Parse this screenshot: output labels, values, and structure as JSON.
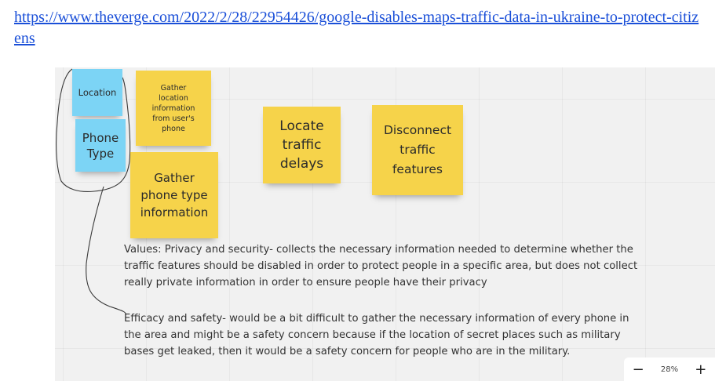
{
  "link": {
    "text": "https://www.theverge.com/2022/2/28/22954426/google-disables-maps-traffic-data-in-ukraine-to-protect-citizens"
  },
  "stickies": {
    "location": "Location",
    "phone_type": "Phone\nType",
    "gather_location": "Gather\nlocation\ninformation\nfrom user's\nphone",
    "gather_phone_type": "Gather\nphone type\ninformation",
    "locate_traffic": "Locate\ntraffic\ndelays",
    "disconnect_traffic": "Disconnect\ntraffic\nfeatures"
  },
  "notes": {
    "values": "Values: Privacy and security- collects the necessary information needed to determine whether the traffic features should be disabled in order to protect people in a specific area, but does not collect really private information in order to ensure people have their privacy",
    "efficacy": "Efficacy and safety- would be a bit difficult to gather the necessary information of every phone in the area and might be a safety concern because if the location of secret places such as military bases get leaked, then it would be a safety concern for people who are in the military."
  },
  "zoom": {
    "minus": "−",
    "level": "28%",
    "plus": "+"
  },
  "colors": {
    "blue_sticky": "#7cd4f5",
    "yellow_sticky": "#f6d34a",
    "link": "#1a4fd8",
    "board": "#f1f1f1"
  }
}
